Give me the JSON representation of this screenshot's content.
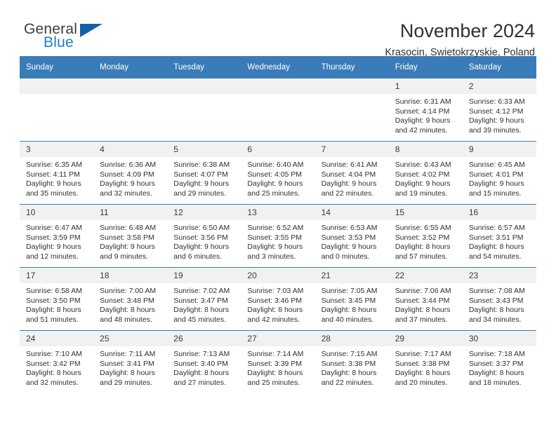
{
  "brand": {
    "name_top": "General",
    "name_bottom": "Blue",
    "color_dark": "#3c3c3c",
    "color_blue": "#1f7dc4",
    "triangle_color": "#1261a8"
  },
  "header": {
    "title": "November 2024",
    "subtitle": "Krasocin, Swietokrzyskie, Poland"
  },
  "theme": {
    "header_row_bg": "#3a7cb8",
    "daynum_bg": "#f1f1f1",
    "grid_line": "#3a7cb8",
    "text": "#303030"
  },
  "labels": {
    "sunrise_prefix": "Sunrise:",
    "sunset_prefix": "Sunset:",
    "daylight_prefix": "Daylight:"
  },
  "weekdays": [
    "Sunday",
    "Monday",
    "Tuesday",
    "Wednesday",
    "Thursday",
    "Friday",
    "Saturday"
  ],
  "weeks": [
    [
      {
        "day": "",
        "empty": true
      },
      {
        "day": "",
        "empty": true
      },
      {
        "day": "",
        "empty": true
      },
      {
        "day": "",
        "empty": true
      },
      {
        "day": "",
        "empty": true
      },
      {
        "day": "1",
        "sunrise": "Sunrise: 6:31 AM",
        "sunset": "Sunset: 4:14 PM",
        "daylight1": "Daylight: 9 hours",
        "daylight2": "and 42 minutes."
      },
      {
        "day": "2",
        "sunrise": "Sunrise: 6:33 AM",
        "sunset": "Sunset: 4:12 PM",
        "daylight1": "Daylight: 9 hours",
        "daylight2": "and 39 minutes."
      }
    ],
    [
      {
        "day": "3",
        "sunrise": "Sunrise: 6:35 AM",
        "sunset": "Sunset: 4:11 PM",
        "daylight1": "Daylight: 9 hours",
        "daylight2": "and 35 minutes."
      },
      {
        "day": "4",
        "sunrise": "Sunrise: 6:36 AM",
        "sunset": "Sunset: 4:09 PM",
        "daylight1": "Daylight: 9 hours",
        "daylight2": "and 32 minutes."
      },
      {
        "day": "5",
        "sunrise": "Sunrise: 6:38 AM",
        "sunset": "Sunset: 4:07 PM",
        "daylight1": "Daylight: 9 hours",
        "daylight2": "and 29 minutes."
      },
      {
        "day": "6",
        "sunrise": "Sunrise: 6:40 AM",
        "sunset": "Sunset: 4:05 PM",
        "daylight1": "Daylight: 9 hours",
        "daylight2": "and 25 minutes."
      },
      {
        "day": "7",
        "sunrise": "Sunrise: 6:41 AM",
        "sunset": "Sunset: 4:04 PM",
        "daylight1": "Daylight: 9 hours",
        "daylight2": "and 22 minutes."
      },
      {
        "day": "8",
        "sunrise": "Sunrise: 6:43 AM",
        "sunset": "Sunset: 4:02 PM",
        "daylight1": "Daylight: 9 hours",
        "daylight2": "and 19 minutes."
      },
      {
        "day": "9",
        "sunrise": "Sunrise: 6:45 AM",
        "sunset": "Sunset: 4:01 PM",
        "daylight1": "Daylight: 9 hours",
        "daylight2": "and 15 minutes."
      }
    ],
    [
      {
        "day": "10",
        "sunrise": "Sunrise: 6:47 AM",
        "sunset": "Sunset: 3:59 PM",
        "daylight1": "Daylight: 9 hours",
        "daylight2": "and 12 minutes."
      },
      {
        "day": "11",
        "sunrise": "Sunrise: 6:48 AM",
        "sunset": "Sunset: 3:58 PM",
        "daylight1": "Daylight: 9 hours",
        "daylight2": "and 9 minutes."
      },
      {
        "day": "12",
        "sunrise": "Sunrise: 6:50 AM",
        "sunset": "Sunset: 3:56 PM",
        "daylight1": "Daylight: 9 hours",
        "daylight2": "and 6 minutes."
      },
      {
        "day": "13",
        "sunrise": "Sunrise: 6:52 AM",
        "sunset": "Sunset: 3:55 PM",
        "daylight1": "Daylight: 9 hours",
        "daylight2": "and 3 minutes."
      },
      {
        "day": "14",
        "sunrise": "Sunrise: 6:53 AM",
        "sunset": "Sunset: 3:53 PM",
        "daylight1": "Daylight: 9 hours",
        "daylight2": "and 0 minutes."
      },
      {
        "day": "15",
        "sunrise": "Sunrise: 6:55 AM",
        "sunset": "Sunset: 3:52 PM",
        "daylight1": "Daylight: 8 hours",
        "daylight2": "and 57 minutes."
      },
      {
        "day": "16",
        "sunrise": "Sunrise: 6:57 AM",
        "sunset": "Sunset: 3:51 PM",
        "daylight1": "Daylight: 8 hours",
        "daylight2": "and 54 minutes."
      }
    ],
    [
      {
        "day": "17",
        "sunrise": "Sunrise: 6:58 AM",
        "sunset": "Sunset: 3:50 PM",
        "daylight1": "Daylight: 8 hours",
        "daylight2": "and 51 minutes."
      },
      {
        "day": "18",
        "sunrise": "Sunrise: 7:00 AM",
        "sunset": "Sunset: 3:48 PM",
        "daylight1": "Daylight: 8 hours",
        "daylight2": "and 48 minutes."
      },
      {
        "day": "19",
        "sunrise": "Sunrise: 7:02 AM",
        "sunset": "Sunset: 3:47 PM",
        "daylight1": "Daylight: 8 hours",
        "daylight2": "and 45 minutes."
      },
      {
        "day": "20",
        "sunrise": "Sunrise: 7:03 AM",
        "sunset": "Sunset: 3:46 PM",
        "daylight1": "Daylight: 8 hours",
        "daylight2": "and 42 minutes."
      },
      {
        "day": "21",
        "sunrise": "Sunrise: 7:05 AM",
        "sunset": "Sunset: 3:45 PM",
        "daylight1": "Daylight: 8 hours",
        "daylight2": "and 40 minutes."
      },
      {
        "day": "22",
        "sunrise": "Sunrise: 7:06 AM",
        "sunset": "Sunset: 3:44 PM",
        "daylight1": "Daylight: 8 hours",
        "daylight2": "and 37 minutes."
      },
      {
        "day": "23",
        "sunrise": "Sunrise: 7:08 AM",
        "sunset": "Sunset: 3:43 PM",
        "daylight1": "Daylight: 8 hours",
        "daylight2": "and 34 minutes."
      }
    ],
    [
      {
        "day": "24",
        "sunrise": "Sunrise: 7:10 AM",
        "sunset": "Sunset: 3:42 PM",
        "daylight1": "Daylight: 8 hours",
        "daylight2": "and 32 minutes."
      },
      {
        "day": "25",
        "sunrise": "Sunrise: 7:11 AM",
        "sunset": "Sunset: 3:41 PM",
        "daylight1": "Daylight: 8 hours",
        "daylight2": "and 29 minutes."
      },
      {
        "day": "26",
        "sunrise": "Sunrise: 7:13 AM",
        "sunset": "Sunset: 3:40 PM",
        "daylight1": "Daylight: 8 hours",
        "daylight2": "and 27 minutes."
      },
      {
        "day": "27",
        "sunrise": "Sunrise: 7:14 AM",
        "sunset": "Sunset: 3:39 PM",
        "daylight1": "Daylight: 8 hours",
        "daylight2": "and 25 minutes."
      },
      {
        "day": "28",
        "sunrise": "Sunrise: 7:15 AM",
        "sunset": "Sunset: 3:38 PM",
        "daylight1": "Daylight: 8 hours",
        "daylight2": "and 22 minutes."
      },
      {
        "day": "29",
        "sunrise": "Sunrise: 7:17 AM",
        "sunset": "Sunset: 3:38 PM",
        "daylight1": "Daylight: 8 hours",
        "daylight2": "and 20 minutes."
      },
      {
        "day": "30",
        "sunrise": "Sunrise: 7:18 AM",
        "sunset": "Sunset: 3:37 PM",
        "daylight1": "Daylight: 8 hours",
        "daylight2": "and 18 minutes."
      }
    ]
  ]
}
